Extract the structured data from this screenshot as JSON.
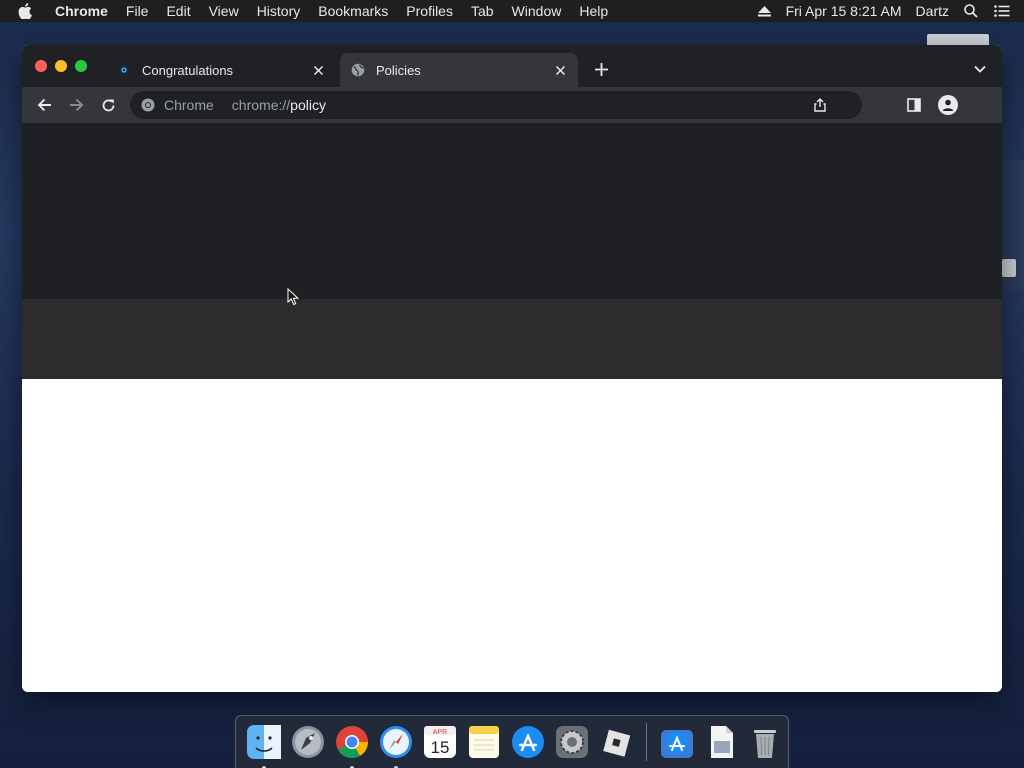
{
  "menubar": {
    "app_name": "Chrome",
    "items": [
      "File",
      "Edit",
      "View",
      "History",
      "Bookmarks",
      "Profiles",
      "Tab",
      "Window",
      "Help"
    ],
    "datetime": "Fri Apr 15  8:21 AM",
    "user": "Dartz"
  },
  "tabs": [
    {
      "title": "Congratulations",
      "active": false
    },
    {
      "title": "Policies",
      "active": true
    }
  ],
  "toolbar": {
    "chip_label": "Chrome",
    "url_scheme": "chrome://",
    "url_path": "policy"
  },
  "dock": {
    "items": [
      "finder-icon",
      "launchpad-icon",
      "chrome-icon",
      "safari-icon",
      "calendar-icon",
      "notes-icon",
      "app-store-icon",
      "system-preferences-icon",
      "roblox-icon",
      "app-store-downloads-icon",
      "document-icon",
      "trash-icon"
    ],
    "calendar_month": "APR",
    "calendar_day": "15"
  },
  "colors": {
    "tab_strip": "#202124",
    "toolbar": "#35363a",
    "omnibox": "#202124",
    "text_primary": "#e8eaed",
    "text_secondary": "#9aa0a6"
  }
}
